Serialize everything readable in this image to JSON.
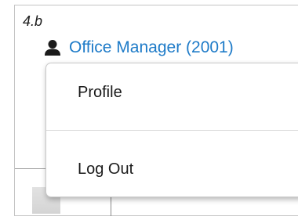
{
  "step_label": "4.b",
  "user": {
    "icon": "user-icon",
    "name": "Office Manager (2001)",
    "name_color": "#1e7bc8"
  },
  "menu": {
    "items": [
      {
        "label": "Profile"
      },
      {
        "label": "Log Out"
      }
    ]
  }
}
